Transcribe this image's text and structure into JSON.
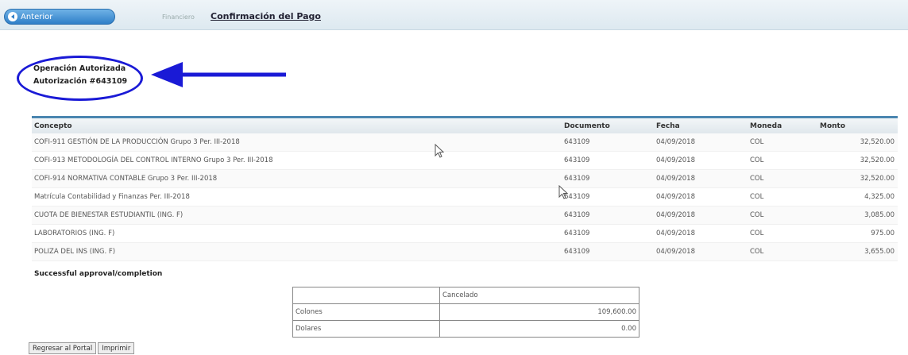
{
  "header": {
    "back_label": "Anterior",
    "breadcrumb": "Financiero",
    "title": "Confirmación del Pago"
  },
  "status": {
    "line1": "Operación Autorizada",
    "line2": "Autorización #643109"
  },
  "grid": {
    "columns": [
      "Concepto",
      "Documento",
      "Fecha",
      "Moneda",
      "Monto"
    ],
    "rows": [
      [
        "COFI-911 GESTIÓN DE LA PRODUCCIÓN Grupo 3 Per. III-2018",
        "643109",
        "04/09/2018",
        "COL",
        "32,520.00"
      ],
      [
        "COFI-913 METODOLOGÍA DEL CONTROL INTERNO Grupo 3 Per. III-2018",
        "643109",
        "04/09/2018",
        "COL",
        "32,520.00"
      ],
      [
        "COFI-914 NORMATIVA CONTABLE Grupo 3 Per. III-2018",
        "643109",
        "04/09/2018",
        "COL",
        "32,520.00"
      ],
      [
        "Matrícula Contabilidad y Finanzas Per. III-2018",
        "643109",
        "04/09/2018",
        "COL",
        "4,325.00"
      ],
      [
        "CUOTA DE BIENESTAR ESTUDIANTIL (ING. F)",
        "643109",
        "04/09/2018",
        "COL",
        "3,085.00"
      ],
      [
        "LABORATORIOS (ING. F)",
        "643109",
        "04/09/2018",
        "COL",
        "975.00"
      ],
      [
        "POLIZA DEL INS (ING. F)",
        "643109",
        "04/09/2018",
        "COL",
        "3,655.00"
      ]
    ]
  },
  "message": "Successful approval/completion",
  "totals": {
    "header": "Cancelado",
    "rows": [
      {
        "label": "Colones",
        "value": "109,600.00"
      },
      {
        "label": "Dolares",
        "value": "0.00"
      }
    ]
  },
  "buttons": {
    "portal": "Regresar al Portal",
    "print": "Imprimir"
  },
  "colors": {
    "accent": "#2f7fc8",
    "annotation": "#1a1ad6"
  }
}
